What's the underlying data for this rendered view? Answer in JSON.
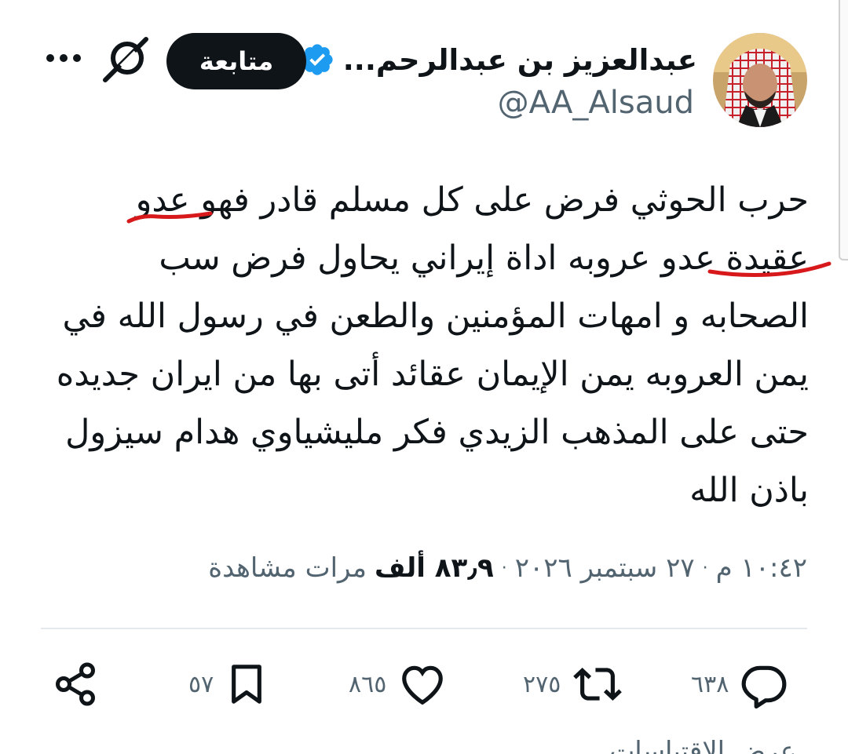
{
  "author": {
    "display_name": "عبدالعزيز بن عبدالرحم...",
    "handle": "@AA_Alsaud",
    "verified": true,
    "avatar": "avatar-photo"
  },
  "header": {
    "follow_label": "متابعة",
    "grok_icon": "grok-icon",
    "more_icon": "more-icon"
  },
  "tweet": {
    "lines": [
      "حرب الحوثي فرض على كل مسلم قادر فهو عدو",
      "عقيدة عدو عروبه اداة إيراني يحاول فرض سب",
      "الصحابه و امهات المؤمنين والطعن في رسول الله في",
      "يمن العروبه يمن الإيمان عقائد أتى بها من ايران جديده",
      "حتى على المذهب الزيدي فكر مليشياوي هدام سيزول",
      "باذن الله"
    ],
    "highlight_color": "#d7191c"
  },
  "meta": {
    "time": "١٠:٤٢ م",
    "date": "٢٧ سبتمبر ٢٠٢٦",
    "separator": "·",
    "views_count": "٨٣٫٩ ألف",
    "views_label": "مرات مشاهدة"
  },
  "actions": {
    "replies": "٦٣٨",
    "reposts": "٢٧٥",
    "likes": "٨٦٥",
    "bookmarks": "٥٧"
  },
  "cut_off_text": "عرض الاقتباسات"
}
